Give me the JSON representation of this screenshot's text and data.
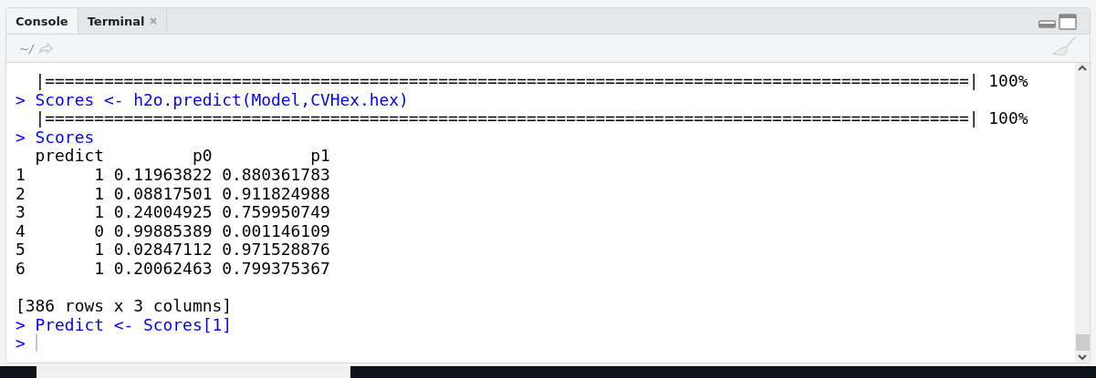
{
  "tabs": [
    {
      "label": "Console",
      "selected": true,
      "closable": false
    },
    {
      "label": "Terminal",
      "selected": false,
      "closable": true
    }
  ],
  "toolbar": {
    "path": "~/"
  },
  "console": {
    "lines": [
      {
        "kind": "output",
        "text": "  |==============================================================================================| 100%"
      },
      {
        "kind": "input",
        "prompt": ">",
        "text": "Scores <- h2o.predict(Model,CVHex.hex)"
      },
      {
        "kind": "output",
        "text": "  |==============================================================================================| 100%"
      },
      {
        "kind": "input",
        "prompt": ">",
        "text": "Scores"
      },
      {
        "kind": "output",
        "text": "  predict         p0          p1"
      },
      {
        "kind": "output",
        "text": "1       1 0.11963822 0.880361783"
      },
      {
        "kind": "output",
        "text": "2       1 0.08817501 0.911824988"
      },
      {
        "kind": "output",
        "text": "3       1 0.24004925 0.759950749"
      },
      {
        "kind": "output",
        "text": "4       0 0.99885389 0.001146109"
      },
      {
        "kind": "output",
        "text": "5       1 0.02847112 0.971528876"
      },
      {
        "kind": "output",
        "text": "6       1 0.20062463 0.799375367"
      },
      {
        "kind": "blank"
      },
      {
        "kind": "output",
        "text": "[386 rows x 3 columns]"
      },
      {
        "kind": "input",
        "prompt": ">",
        "text": "Predict <- Scores[1]"
      },
      {
        "kind": "cursor",
        "prompt": ">"
      }
    ]
  }
}
